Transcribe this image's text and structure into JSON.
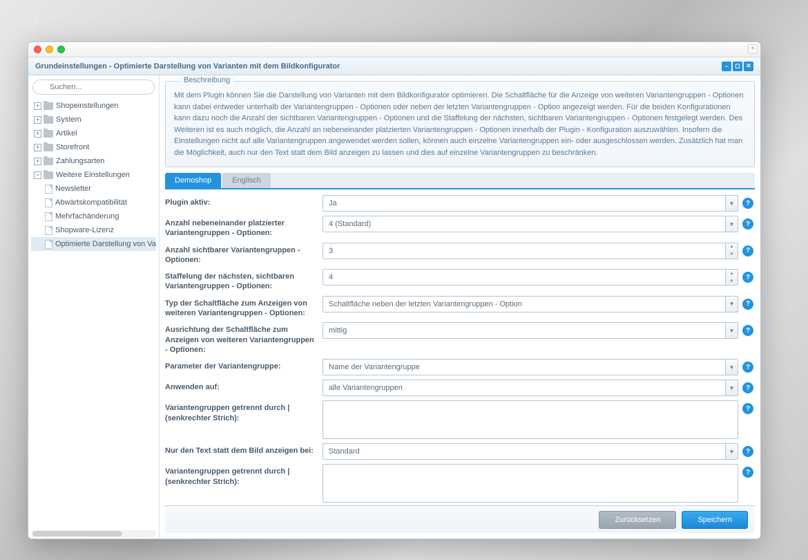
{
  "window": {
    "title": "Grundeinstellungen - Optimierte Darstellung von Varianten mit dem Bildkonfigurator"
  },
  "sidebar": {
    "search_placeholder": "Suchen...",
    "items": [
      {
        "label": "Shopeinstellungen",
        "type": "folder",
        "expanded": false
      },
      {
        "label": "System",
        "type": "folder",
        "expanded": false
      },
      {
        "label": "Artikel",
        "type": "folder",
        "expanded": false
      },
      {
        "label": "Storefront",
        "type": "folder",
        "expanded": false
      },
      {
        "label": "Zahlungsarten",
        "type": "folder",
        "expanded": false
      },
      {
        "label": "Weitere Einstellungen",
        "type": "folder",
        "expanded": true
      }
    ],
    "children": [
      {
        "label": "Newsletter"
      },
      {
        "label": "Abwärtskompatibilität"
      },
      {
        "label": "Mehrfachänderung"
      },
      {
        "label": "Shopware-Lizenz"
      },
      {
        "label": "Optimierte Darstellung von Va"
      }
    ]
  },
  "description": {
    "legend": "Beschreibung",
    "text": "Mit dem Plugin können Sie die Darstellung von Varianten mit dem Bildkonfigurator optimieren. Die Schaltfläche für die Anzeige von weiteren Variantengruppen - Optionen kann dabei entweder unterhalb der Variantengruppen - Optionen oder neben der letzten Variantengruppen - Option angezeigt werden. Für die beiden Konfigurationen kann dazu noch die Anzahl der sichtbaren Variantengruppen - Optionen und die Staffelung der nächsten, sichtbaren Variantengruppen - Optionen festgelegt werden. Des Weiteren ist es auch möglich, die Anzahl an nebeneinander platzierten Variantengruppen - Optionen innerhalb der Plugin - Konfiguration auszuwählen. Insofern die Einstellungen nicht auf alle Variantengruppen angewendet werden sollen, können auch einzelne Variantengruppen ein- oder ausgeschlossen werden. Zusätzlich hat man die Möglichkeit, auch nur den Text statt dem Bild anzeigen zu lassen und dies auf einzelne Variantengruppen zu beschränken."
  },
  "tabs": [
    {
      "label": "Demoshop",
      "active": true
    },
    {
      "label": "Englisch",
      "active": false
    }
  ],
  "form": {
    "rows": [
      {
        "label": "Plugin aktiv:",
        "value": "Ja",
        "type": "select",
        "help": true
      },
      {
        "label": "Anzahl nebeneinander platzierter Variantengruppen - Optionen:",
        "value": "4 (Standard)",
        "type": "select",
        "help": true
      },
      {
        "label": "Anzahl sichtbarer Variantengruppen - Optionen:",
        "value": "3",
        "type": "spinner",
        "help": true
      },
      {
        "label": "Staffelung der nächsten, sichtbaren Variantengruppen - Optionen:",
        "value": "4",
        "type": "spinner",
        "help": true
      },
      {
        "label": "Typ der Schaltfläche zum Anzeigen von weiteren Variantengruppen - Optionen:",
        "value": "Schaltfläche neben der letzten Variantengruppen - Option",
        "type": "select",
        "help": true
      },
      {
        "label": "Ausrichtung der Schaltfläche zum Anzeigen von weiteren Variantengruppen - Optionen:",
        "value": "mittig",
        "type": "select",
        "help": true
      },
      {
        "label": "Parameter der Variantengruppe:",
        "value": "Name der Variantengruppe",
        "type": "select",
        "help": true
      },
      {
        "label": "Anwenden auf:",
        "value": "alle Variantengruppen",
        "type": "select",
        "help": true
      },
      {
        "label": "Variantengruppen getrennt durch | (senkrechter Strich):",
        "value": "",
        "type": "textarea",
        "help": true
      },
      {
        "label": "Nur den Text statt dem Bild anzeigen bei:",
        "value": "Standard",
        "type": "select",
        "help": true
      },
      {
        "label": "Variantengruppen getrennt durch | (senkrechter Strich):",
        "value": "",
        "type": "textarea",
        "help": true
      }
    ]
  },
  "footer": {
    "reset_label": "Zurücksetzen",
    "save_label": "Speichern"
  }
}
